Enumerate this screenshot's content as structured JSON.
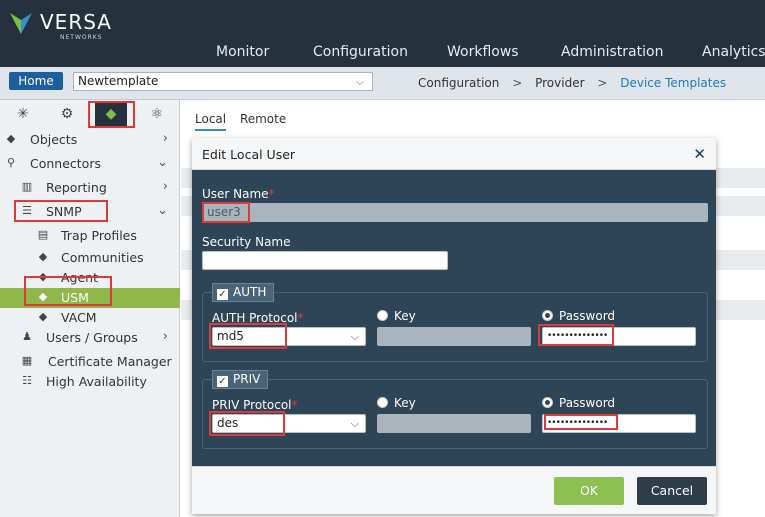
{
  "brand": {
    "name": "VERSA",
    "sub": "NETWORKS"
  },
  "nav": [
    "Monitor",
    "Configuration",
    "Workflows",
    "Administration",
    "Analytics"
  ],
  "subbar": {
    "home": "Home",
    "template": "Newtemplate",
    "crumbs": [
      "Configuration",
      ">",
      "Provider",
      ">",
      "Device Templates"
    ]
  },
  "sidebar": {
    "tabs": [
      "network-icon",
      "gear-icon",
      "cube-icon",
      "services-icon"
    ],
    "items": [
      {
        "label": "Objects",
        "icon": "cube-icon",
        "arrow": "›"
      },
      {
        "label": "Connectors",
        "icon": "connector-icon",
        "arrow": "⌄"
      },
      {
        "label": "Reporting",
        "icon": "chart-icon",
        "arrow": "›"
      },
      {
        "label": "SNMP",
        "icon": "snmp-icon",
        "arrow": "⌄"
      },
      {
        "label": "Trap Profiles",
        "icon": "trap-icon"
      },
      {
        "label": "Communities",
        "icon": "cube-icon"
      },
      {
        "label": "Agent",
        "icon": "cube-icon"
      },
      {
        "label": "USM",
        "icon": "cube-icon"
      },
      {
        "label": "VACM",
        "icon": "cube-icon"
      },
      {
        "label": "Users / Groups",
        "icon": "user-icon",
        "arrow": "›"
      },
      {
        "label": "Certificate Manager",
        "icon": "certificate-icon"
      },
      {
        "label": "High Availability",
        "icon": "server-icon"
      }
    ]
  },
  "content": {
    "tabs": [
      "Local",
      "Remote"
    ]
  },
  "modal": {
    "title": "Edit Local User",
    "close": "✕",
    "user_name_label": "User Name",
    "user_name_value": "user3",
    "security_name_label": "Security Name",
    "security_name_value": "",
    "auth": {
      "tag": "AUTH",
      "protocol_label": "AUTH Protocol",
      "protocol_value": "md5",
      "key_label": "Key",
      "password_label": "Password",
      "password_value": "••••••••••••••"
    },
    "priv": {
      "tag": "PRIV",
      "protocol_label": "PRIV Protocol",
      "protocol_value": "des",
      "key_label": "Key",
      "password_label": "Password",
      "password_value": "••••••••••••••"
    },
    "ok": "OK",
    "cancel": "Cancel"
  },
  "colors": {
    "header": "#25323e",
    "modal": "#2e4457",
    "ok": "#8cc152",
    "highlight": "#e0393a",
    "selected": "#8fb848"
  }
}
